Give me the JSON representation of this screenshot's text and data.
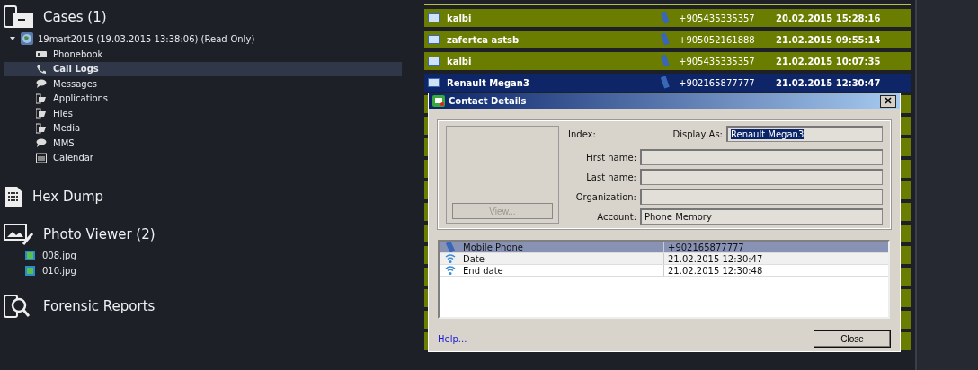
{
  "sidebar": {
    "sections": [
      {
        "kind": "cases",
        "title": "Cases (1)",
        "cases": [
          {
            "label": "19mart2015 (19.03.2015 13:38:06) (Read-Only)",
            "expanded": true,
            "items": [
              {
                "label": "Phonebook",
                "kind": "phonebook",
                "selected": false
              },
              {
                "label": "Call Logs",
                "kind": "call",
                "selected": true
              },
              {
                "label": "Messages",
                "kind": "message",
                "selected": false
              },
              {
                "label": "Applications",
                "kind": "folder",
                "selected": false
              },
              {
                "label": "Files",
                "kind": "folder",
                "selected": false
              },
              {
                "label": "Media",
                "kind": "folder",
                "selected": false
              },
              {
                "label": "MMS",
                "kind": "message",
                "selected": false
              },
              {
                "label": "Calendar",
                "kind": "calendar",
                "selected": false
              }
            ]
          }
        ]
      },
      {
        "kind": "hex",
        "title": "Hex Dump"
      },
      {
        "kind": "photo",
        "title": "Photo Viewer (2)",
        "files": [
          {
            "label": "008.jpg"
          },
          {
            "label": "010.jpg"
          }
        ]
      },
      {
        "kind": "reports",
        "title": "Forensic Reports"
      }
    ]
  },
  "call_list": {
    "rows": [
      {
        "name": "kalbi",
        "number": "+905435335357",
        "time": "20.02.2015 15:28:16",
        "selected": false
      },
      {
        "name": "zafertca astsb",
        "number": "+905052161888",
        "time": "21.02.2015 09:55:14",
        "selected": false
      },
      {
        "name": "kalbi",
        "number": "+905435335357",
        "time": "21.02.2015 10:07:35",
        "selected": false
      },
      {
        "name": "Renault Megan3",
        "number": "+902165877777",
        "time": "21.02.2015 12:30:47",
        "selected": true
      }
    ]
  },
  "dialog": {
    "title": "Contact Details",
    "index_label": "Index:",
    "display_as": {
      "label": "Display As:",
      "value": "Renault Megan3"
    },
    "fields": [
      {
        "label": "First name:"
      },
      {
        "label": "Last name:"
      },
      {
        "label": "Organization:"
      },
      {
        "label": "Account:",
        "value": "Phone Memory"
      }
    ],
    "view_button": {
      "label": "View...",
      "disabled": true
    },
    "properties": [
      {
        "kind": "phone",
        "name": "Mobile Phone",
        "value": "+902165877777",
        "selected": true
      },
      {
        "kind": "info",
        "name": "Date",
        "value": "21.02.2015 12:30:47",
        "selected": false
      },
      {
        "kind": "info",
        "name": "End date",
        "value": "21.02.2015 12:30:48",
        "selected": false
      }
    ],
    "help_link": "Help...",
    "close_button": "Close"
  }
}
